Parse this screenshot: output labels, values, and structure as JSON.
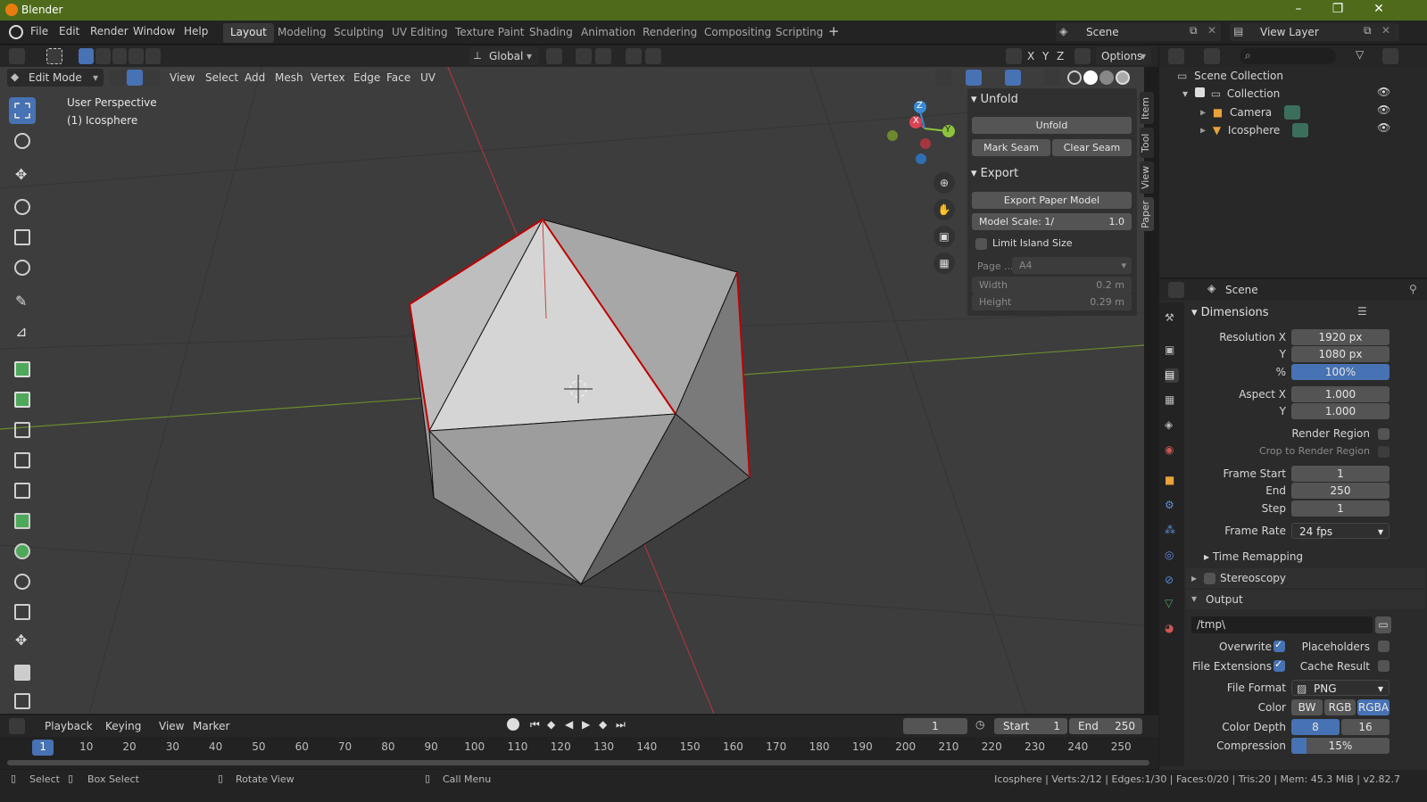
{
  "app": {
    "title": "Blender"
  },
  "menu": [
    "File",
    "Edit",
    "Render",
    "Window",
    "Help"
  ],
  "workspaces": [
    "Layout",
    "Modeling",
    "Sculpting",
    "UV Editing",
    "Texture Paint",
    "Shading",
    "Animation",
    "Rendering",
    "Compositing",
    "Scripting"
  ],
  "scene": {
    "name": "Scene",
    "view_layer": "View Layer"
  },
  "viewport": {
    "transform": "Global",
    "options": "Options",
    "mode": "Edit Mode",
    "header_menus": [
      "View",
      "Select",
      "Add",
      "Mesh",
      "Vertex",
      "Edge",
      "Face",
      "UV"
    ],
    "overlay_title": "User Perspective",
    "overlay_object": "(1) Icosphere",
    "axes": {
      "x": "X",
      "y": "Y",
      "z": "Z"
    }
  },
  "npanel": {
    "tabs": [
      "Item",
      "Tool",
      "View",
      "Paper"
    ],
    "unfold": {
      "title": "Unfold",
      "button": "Unfold",
      "mark": "Mark Seam",
      "clear": "Clear Seam"
    },
    "export": {
      "title": "Export",
      "button": "Export Paper Model",
      "scale_label": "Model Scale: 1/",
      "scale_value": "1.0",
      "limit": "Limit Island Size",
      "page_label": "Page ...",
      "page_value": "A4",
      "width_label": "Width",
      "width_value": "0.2 m",
      "height_label": "Height",
      "height_value": "0.29 m"
    }
  },
  "outliner": {
    "root": "Scene Collection",
    "collection": "Collection",
    "items": [
      "Camera",
      "Icosphere"
    ]
  },
  "properties": {
    "context": "Scene",
    "dimensions": "Dimensions",
    "res_x_label": "Resolution X",
    "res_x": "1920 px",
    "res_y_label": "Y",
    "res_y": "1080 px",
    "pct_label": "%",
    "pct": "100%",
    "asp_x_label": "Aspect X",
    "asp_x": "1.000",
    "asp_y_label": "Y",
    "asp_y": "1.000",
    "render_region": "Render Region",
    "crop": "Crop to Render Region",
    "fs_label": "Frame Start",
    "fs": "1",
    "end_label": "End",
    "end": "250",
    "step_label": "Step",
    "step": "1",
    "fr_label": "Frame Rate",
    "fr": "24 fps",
    "time_remap": "Time Remapping",
    "stereo": "Stereoscopy",
    "output": "Output",
    "path": "/tmp\\",
    "overwrite": "Overwrite",
    "placeholders": "Placeholders",
    "file_ext": "File Extensions",
    "cache": "Cache Result",
    "ff_label": "File Format",
    "ff": "PNG",
    "color_label": "Color",
    "color_opts": [
      "BW",
      "RGB",
      "RGBA"
    ],
    "depth_label": "Color Depth",
    "depth_opts": [
      "8",
      "16"
    ],
    "comp_label": "Compression",
    "comp": "15%"
  },
  "timeline": {
    "menus": [
      "Playback",
      "Keying",
      "View",
      "Marker"
    ],
    "current": "1",
    "start_label": "Start",
    "start": "1",
    "end_label": "End",
    "end": "250",
    "ticks": [
      "1",
      "10",
      "20",
      "30",
      "40",
      "50",
      "60",
      "70",
      "80",
      "90",
      "100",
      "110",
      "120",
      "130",
      "140",
      "150",
      "160",
      "170",
      "180",
      "190",
      "200",
      "210",
      "220",
      "230",
      "240",
      "250"
    ]
  },
  "status": {
    "select": "Select",
    "box": "Box Select",
    "rotate": "Rotate View",
    "menu": "Call Menu",
    "stats": "Icosphere | Verts:2/12 | Edges:1/30 | Faces:0/20 | Tris:20 | Mem: 45.3 MiB | v2.82.7"
  },
  "colors": {
    "title_bar": "#4e6a1a",
    "accent": "#4772b3",
    "seam": "#c00000",
    "x_axis": "#d94452",
    "y_axis": "#8cc43d",
    "z_axis": "#3b8ad6"
  }
}
